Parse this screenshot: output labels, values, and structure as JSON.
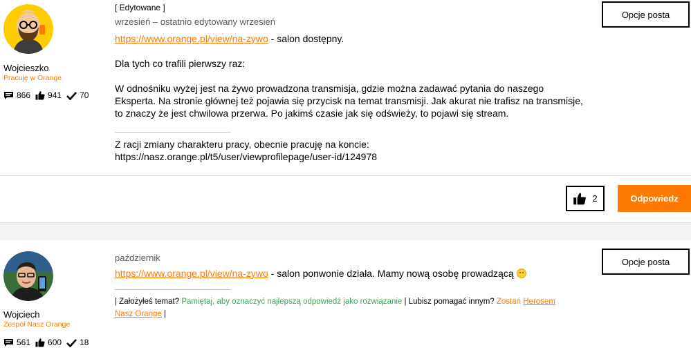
{
  "post1": {
    "username": "Wojcieszko",
    "role": "Pracuję w Orange",
    "stats": {
      "posts": "866",
      "likes": "941",
      "solutions": "70"
    },
    "edited_label": "[ Edytowane ]",
    "date": "wrzesień – ostatnio edytowany wrzesień",
    "options_label": "Opcje posta",
    "link": "https://www.orange.pl/view/na-zywo",
    "link_suffix": " - salon dostępny.",
    "para1": "Dla tych co trafili pierwszy raz:",
    "para2": "W odnośniku wyżej jest na żywo prowadzona transmisja, gdzie można zadawać pytania do naszego Eksperta. Na stronie głównej też pojawia się przycisk na temat transmisji. Jak akurat nie trafisz na transmisje, to znaczy że jest chwilowa przerwa. Po jakimś czasie jak się odświeży, to pojawi się stream.",
    "signature_line1": "Z racji zmiany charakteru pracy, obecnie pracuję na koncie:",
    "signature_line2": "https://nasz.orange.pl/t5/user/viewprofilepage/user-id/124978",
    "like_count": "2",
    "reply_label": "Odpowiedz"
  },
  "post2": {
    "username": "Wojciech",
    "role": "Zespół Nasz Orange",
    "stats": {
      "posts": "561",
      "likes": "600",
      "solutions": "18"
    },
    "date": "październik",
    "options_label": "Opcje posta",
    "link": "https://www.orange.pl/view/na-zywo",
    "link_suffix": " - salon ponwonie działa. Mamy nową osobę prowadzącą ",
    "sig_part1": "| Założyłeś temat? ",
    "sig_part2": "Pamiętaj, aby oznaczyć najlepszą odpowiedź jako rozwiązanie",
    "sig_part3": " | Lubisz pomagać innym? ",
    "sig_part4": "Zostań ",
    "sig_part5": "Herosem Nasz Orange",
    "sig_part6": " |"
  },
  "colors": {
    "accent": "#ff7900",
    "green": "#3ea55a"
  }
}
